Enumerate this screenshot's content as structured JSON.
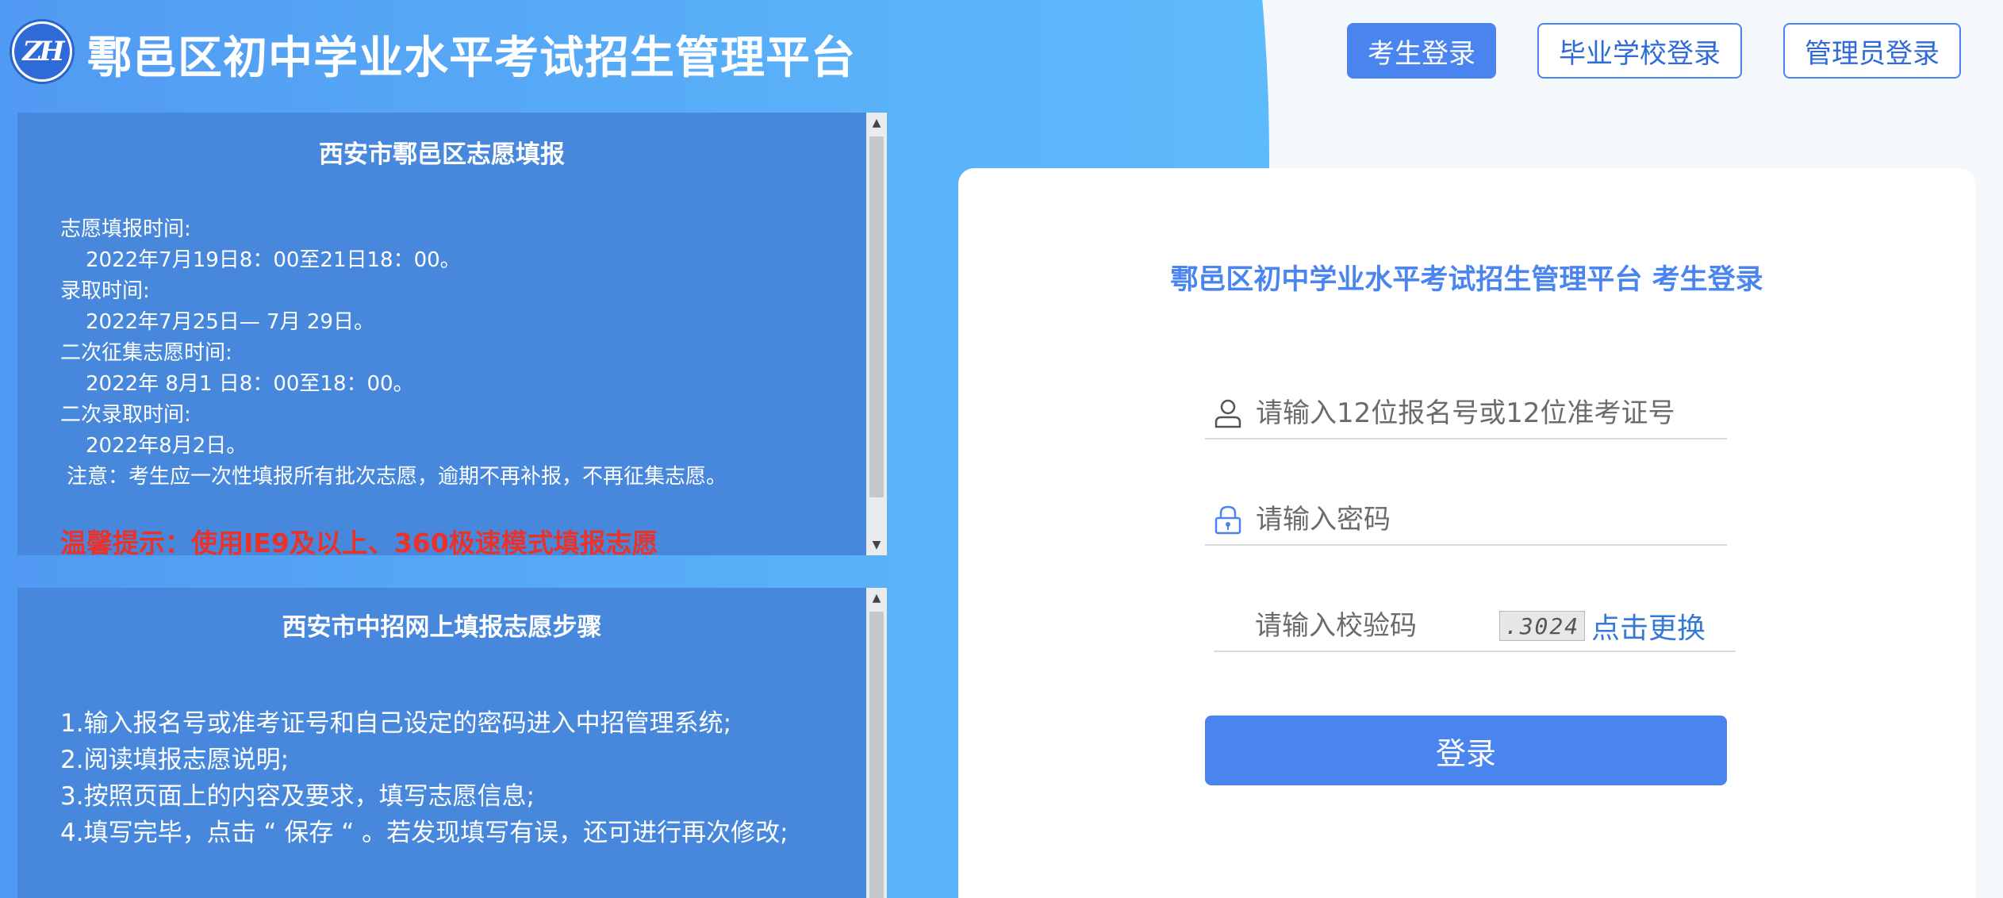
{
  "site_title": "鄠邑区初中学业水平考试招生管理平台",
  "logo_text": "ZH",
  "nav": {
    "student_login": "考生登录",
    "school_login": "毕业学校登录",
    "admin_login": "管理员登录"
  },
  "panel1": {
    "title": "西安市鄠邑区志愿填报",
    "lines": [
      "志愿填报时间:",
      "2022年7月19日8：00至21日18：00。",
      "录取时间:",
      "2022年7月25日— 7月 29日。",
      "二次征集志愿时间:",
      "2022年 8月1 日8：00至18：00。",
      "二次录取时间:",
      "2022年8月2日。",
      "注意：考生应一次性填报所有批次志愿，逾期不再补报，不再征集志愿。"
    ],
    "warning": "温馨提示：使用IE9及以上、360极速模式填报志愿"
  },
  "panel2": {
    "title": "西安市中招网上填报志愿步骤",
    "steps": [
      "1.输入报名号或准考证号和自己设定的密码进入中招管理系统;",
      "2.阅读填报志愿说明;",
      "3.按照页面上的内容及要求，填写志愿信息;",
      "4.填写完毕，点击 “ 保存 “ 。若发现填写有误，还可进行再次修改;"
    ]
  },
  "login": {
    "title": "鄠邑区初中学业水平考试招生管理平台 考生登录",
    "username_placeholder": "请输入12位报名号或12位准考证号",
    "password_placeholder": "请输入密码",
    "captcha_placeholder": "请输入校验码",
    "captcha_value": ".3024",
    "refresh_label": "点击更换",
    "submit_label": "登录"
  },
  "colors": {
    "primary": "#4a84ef",
    "panel_bg": "#4788dd",
    "warning": "#e8322a"
  }
}
